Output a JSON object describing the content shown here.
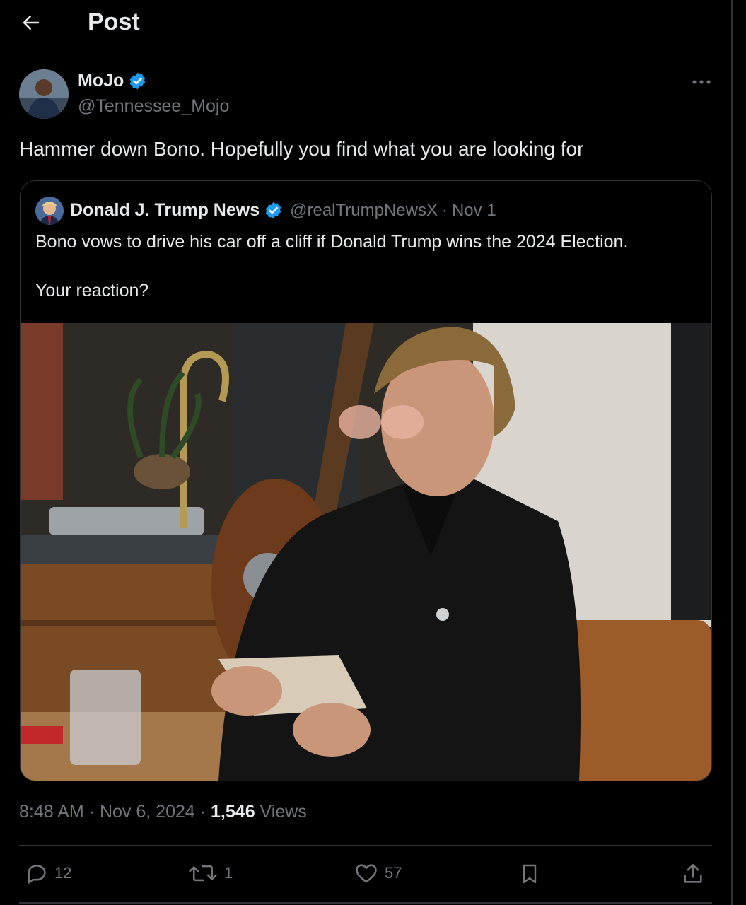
{
  "header": {
    "title": "Post",
    "back_icon": "arrow-left-icon"
  },
  "author": {
    "name": "MoJo",
    "handle": "@Tennessee_Mojo",
    "verified": true,
    "verified_color": "#1d9bf0"
  },
  "post": {
    "text": "Hammer down Bono. Hopefully you find what you are looking for"
  },
  "quote": {
    "name": "Donald J. Trump News",
    "handle": "@realTrumpNewsX",
    "separator": "·",
    "date": "Nov 1",
    "text_line1": "Bono vows to drive his car off a cliff if Donald Trump wins the 2024 Election.",
    "text_line2": "Your reaction?"
  },
  "meta": {
    "time": "8:48 AM",
    "sep": "·",
    "date": "Nov 6, 2024",
    "views_count": "1,546",
    "views_label": "Views"
  },
  "actions": {
    "replies": "12",
    "reposts": "1",
    "likes": "57"
  },
  "colors": {
    "background": "#000000",
    "text": "#e7e9ea",
    "secondary": "#71767b",
    "border": "#2f3336",
    "accent": "#1d9bf0"
  }
}
